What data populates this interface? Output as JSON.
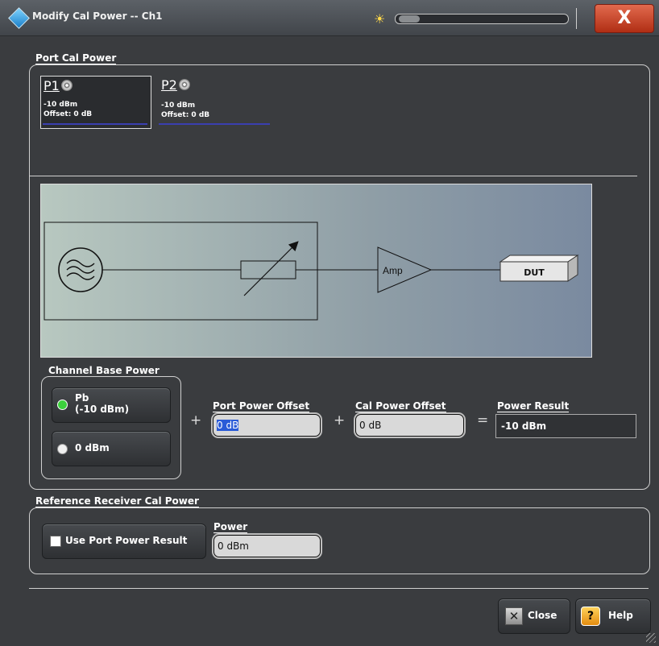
{
  "window": {
    "title": "Modify Cal Power -- Ch1",
    "close_glyph": "X"
  },
  "port_cal_power": {
    "label": "Port Cal Power",
    "ports": [
      {
        "name": "P1",
        "power": "-10 dBm",
        "offset": "Offset: 0 dB",
        "selected": true
      },
      {
        "name": "P2",
        "power": "-10 dBm",
        "offset": "Offset: 0 dB",
        "selected": false
      }
    ]
  },
  "diagram": {
    "amp_label": "Amp",
    "dut_label": "DUT"
  },
  "channel_base_power": {
    "label": "Channel Base Power",
    "options": [
      {
        "line1": "Pb",
        "line2": "(-10 dBm)",
        "selected": true
      },
      {
        "line1": "0 dBm",
        "line2": "",
        "selected": false
      }
    ]
  },
  "port_power_offset": {
    "label": "Port Power Offset",
    "value": "0 dB"
  },
  "cal_power_offset": {
    "label": "Cal Power Offset",
    "value": "0 dB"
  },
  "power_result": {
    "label": "Power Result",
    "value": "-10 dBm"
  },
  "operators": {
    "plus": "+",
    "equals": "="
  },
  "reference_receiver": {
    "label": "Reference Receiver Cal Power",
    "use_port_power_result": {
      "label": "Use Port Power Result",
      "checked": false
    },
    "power": {
      "label": "Power",
      "value": "0 dBm"
    }
  },
  "footer": {
    "close_label": "Close",
    "help_label": "Help"
  },
  "colors": {
    "accent_blue": "#3a3fb0",
    "radio_selected": "#3cd13c",
    "title_close_red": "#c94228"
  }
}
